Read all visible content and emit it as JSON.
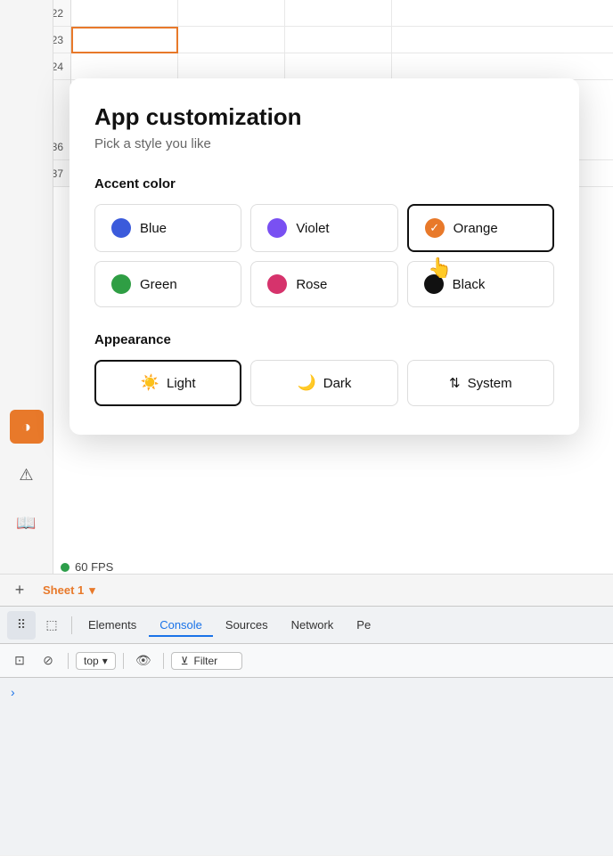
{
  "modal": {
    "title": "App customization",
    "subtitle": "Pick a style you like",
    "accent_label": "Accent color",
    "appearance_label": "Appearance",
    "colors": [
      {
        "id": "blue",
        "label": "Blue",
        "dot": "blue",
        "selected": false
      },
      {
        "id": "violet",
        "label": "Violet",
        "dot": "violet",
        "selected": false
      },
      {
        "id": "orange",
        "label": "Orange",
        "dot": "orange",
        "selected": true
      },
      {
        "id": "green",
        "label": "Green",
        "dot": "green",
        "selected": false
      },
      {
        "id": "rose",
        "label": "Rose",
        "dot": "rose",
        "selected": false
      },
      {
        "id": "black",
        "label": "Black",
        "dot": "black",
        "selected": false
      }
    ],
    "appearances": [
      {
        "id": "light",
        "label": "Light",
        "icon": "☀",
        "selected": true
      },
      {
        "id": "dark",
        "label": "Dark",
        "icon": "☽",
        "selected": false
      },
      {
        "id": "system",
        "label": "System",
        "icon": "⇅",
        "selected": false
      }
    ]
  },
  "spreadsheet": {
    "row_numbers": [
      "22",
      "23",
      "24",
      "36",
      "37"
    ],
    "fps": "60 FPS",
    "sheet_tab": "Sheet 1"
  },
  "devtools": {
    "tabs": [
      "Elements",
      "Console",
      "Sources",
      "Network",
      "Pe"
    ],
    "active_tab": "Console",
    "toolbar": {
      "top_label": "top",
      "filter_label": "Filter"
    }
  }
}
